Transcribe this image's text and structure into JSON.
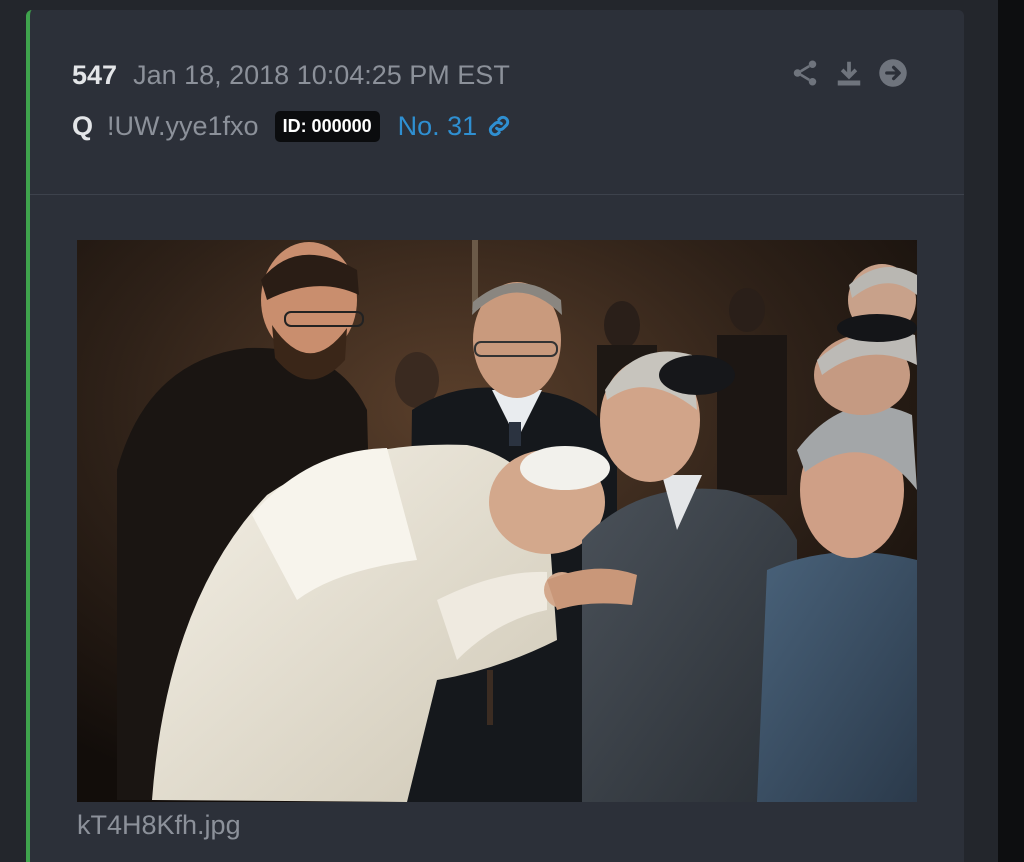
{
  "post": {
    "number": "547",
    "date": "Jan 18, 2018 10:04:25 PM EST",
    "author": "Q",
    "tripcode": "!UW.yye1fxo",
    "id_badge": "ID: 000000",
    "post_link": "No. 31"
  },
  "icons": {
    "share": "share-icon",
    "download": "download-icon",
    "forward": "arrow-right-circle-icon",
    "link": "link-icon"
  },
  "attachment": {
    "filename": "kT4H8Kfh.jpg"
  },
  "colors": {
    "accent_green": "#3fa34d",
    "link_blue": "#2f8fd1",
    "card_bg": "#2c3039",
    "badge_bg": "#0b0c0e"
  }
}
